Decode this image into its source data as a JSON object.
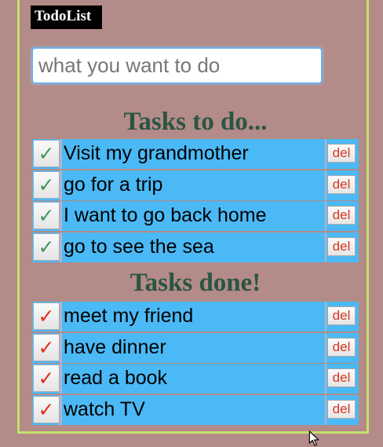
{
  "app": {
    "logo": "TodoList"
  },
  "input": {
    "placeholder": "what you want to do",
    "value": ""
  },
  "todo": {
    "title": "Tasks to do...",
    "check_glyph": "✓",
    "del_label": "del",
    "items": [
      {
        "label": "Visit my grandmother"
      },
      {
        "label": "go for a trip"
      },
      {
        "label": "I want to go back home"
      },
      {
        "label": "go to see the sea"
      }
    ]
  },
  "done": {
    "title": "Tasks done!",
    "check_glyph": "✓",
    "del_label": "del",
    "items": [
      {
        "label": "meet my friend"
      },
      {
        "label": "have dinner"
      },
      {
        "label": "read a book"
      },
      {
        "label": "watch TV"
      }
    ]
  },
  "colors": {
    "background": "#b38b88",
    "frame": "#c6e06a",
    "row": "#4bb9f5",
    "title": "#2b5543",
    "todo_check": "#3d9a5c",
    "done_check": "#e0301e",
    "del_text": "#d8361f"
  }
}
